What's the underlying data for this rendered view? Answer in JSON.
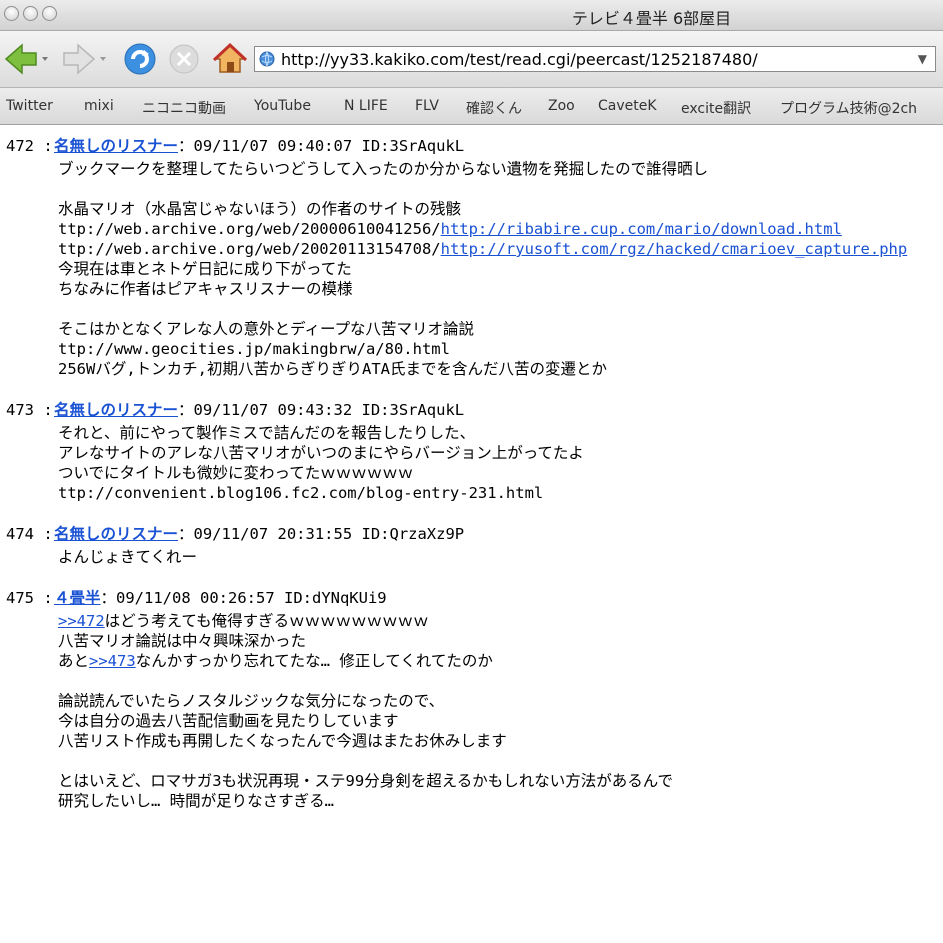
{
  "window": {
    "title": "テレビ４畳半 6部屋目"
  },
  "nav": {
    "url": "http://yy33.kakiko.com/test/read.cgi/peercast/1252187480/",
    "icons": [
      "back-arrow-icon",
      "forward-arrow-icon",
      "reload-icon",
      "stop-icon",
      "home-icon",
      "globe-icon",
      "dropdown-triangle-icon"
    ]
  },
  "bookmarks": [
    "Twitter",
    "mixi",
    "ニコニコ動画",
    "YouTube",
    "N LIFE",
    "FLV",
    "確認くん",
    "Zoo",
    "CaveteK",
    "excite翻訳",
    "プログラム技術@2ch"
  ],
  "posts": [
    {
      "num": "472",
      "name": "名無しのリスナー",
      "meta": "：09/11/07 09:40:07 ID:3SrAqukL",
      "lines": [
        [
          {
            "t": "ブックマークを整理してたらいつどうして入ったのか分からない遺物を発掘したので誰得晒し"
          }
        ],
        [],
        [
          {
            "t": "水晶マリオ（水晶宮じゃないほう）の作者のサイトの残骸"
          }
        ],
        [
          {
            "t": "ttp://web.archive.org/web/20000610041256/"
          },
          {
            "t": "http://ribabire.cup.com/mario/download.html",
            "link": true
          }
        ],
        [
          {
            "t": "ttp://web.archive.org/web/20020113154708/"
          },
          {
            "t": "http://ryusoft.com/rgz/hacked/cmarioev_capture.php",
            "link": true
          }
        ],
        [
          {
            "t": "今現在は車とネトゲ日記に成り下がってた"
          }
        ],
        [
          {
            "t": "ちなみに作者はピアキャスリスナーの模様"
          }
        ],
        [],
        [
          {
            "t": "そこはかとなくアレな人の意外とディープな八苦マリオ論説"
          }
        ],
        [
          {
            "t": "ttp://www.geocities.jp/makingbrw/a/80.html"
          }
        ],
        [
          {
            "t": "256Wバグ,トンカチ,初期八苦からぎりぎりATA氏までを含んだ八苦の変遷とか"
          }
        ]
      ]
    },
    {
      "num": "473",
      "name": "名無しのリスナー",
      "meta": "：09/11/07 09:43:32 ID:3SrAqukL",
      "lines": [
        [
          {
            "t": "それと、前にやって製作ミスで詰んだのを報告したりした、"
          }
        ],
        [
          {
            "t": "アレなサイトのアレな八苦マリオがいつのまにやらバージョン上がってたよ"
          }
        ],
        [
          {
            "t": "ついでにタイトルも微妙に変わってたｗｗｗｗｗｗ"
          }
        ],
        [
          {
            "t": "ttp://convenient.blog106.fc2.com/blog-entry-231.html"
          }
        ]
      ]
    },
    {
      "num": "474",
      "name": "名無しのリスナー",
      "meta": "：09/11/07 20:31:55 ID:QrzaXz9P",
      "lines": [
        [
          {
            "t": "よんじょきてくれー"
          }
        ]
      ]
    },
    {
      "num": "475",
      "name": "４畳半",
      "meta": "：09/11/08 00:26:57 ID:dYNqKUi9",
      "lines": [
        [
          {
            "t": ">>472",
            "link": true
          },
          {
            "t": "はどう考えても俺得すぎるｗｗｗｗｗｗｗｗｗ"
          }
        ],
        [
          {
            "t": "八苦マリオ論説は中々興味深かった"
          }
        ],
        [
          {
            "t": "あと"
          },
          {
            "t": ">>473",
            "link": true
          },
          {
            "t": "なんかすっかり忘れてたな… 修正してくれてたのか"
          }
        ],
        [],
        [
          {
            "t": "論説読んでいたらノスタルジックな気分になったので、"
          }
        ],
        [
          {
            "t": "今は自分の過去八苦配信動画を見たりしています"
          }
        ],
        [
          {
            "t": "八苦リスト作成も再開したくなったんで今週はまたお休みします"
          }
        ],
        [],
        [
          {
            "t": "とはいえど、ロマサガ3も状況再現・ステ99分身剣を超えるかもしれない方法があるんで"
          }
        ],
        [
          {
            "t": "研究したいし… 時間が足りなさすぎる…"
          }
        ]
      ]
    }
  ]
}
